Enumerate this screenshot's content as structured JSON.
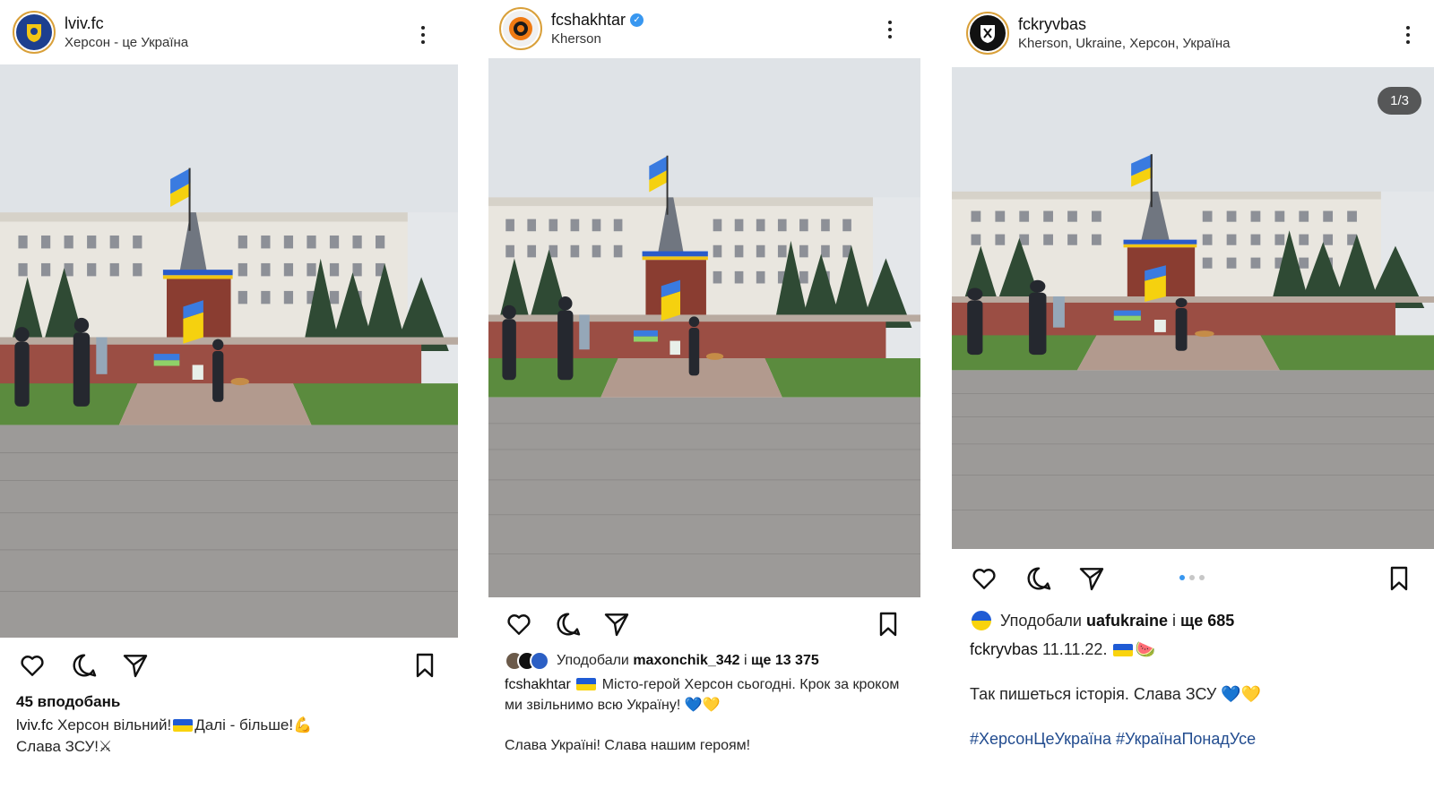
{
  "posts": [
    {
      "username": "lviv.fc",
      "location": "Херсон - це Україна",
      "verified": false,
      "likes_text": "45 вподобань",
      "caption_user": "lviv.fc",
      "caption_line1": "Херсон вільний!",
      "caption_after_flag": "Далі - більше!",
      "flex_emoji": "💪",
      "caption_line2": "Слава ЗСУ!",
      "swords_emoji": "⚔"
    },
    {
      "username": "fcshakhtar",
      "location": "Kherson",
      "verified": true,
      "liked_by_prefix": "Уподобали",
      "liked_by_user": "maxonchik_342",
      "liked_by_mid": "і",
      "liked_by_count": "ще 13 375",
      "caption_user": "fcshakhtar",
      "caption_text": "Місто-герой Херсон сьогодні. Крок за кроком ми звільнимо всю Україну!",
      "hearts": "💙💛",
      "caption_line2": "Слава Україні! Слава нашим героям!"
    },
    {
      "username": "fckryvbas",
      "location": "Kherson, Ukraine, Херсон, Україна",
      "verified": false,
      "photo_counter": "1/3",
      "liked_by_prefix": "Уподобали",
      "liked_by_user": "uafukraine",
      "liked_by_mid": "і",
      "liked_by_count": "ще 685",
      "caption_user": "fckryvbas",
      "caption_date": "11.11.22.",
      "watermelon": "🍉",
      "caption_line2": "Так пишеться історія. Слава ЗСУ",
      "hearts": "💙💛",
      "hashtags": "#ХерсонЦеУкраїна #УкраїнаПонадУсе",
      "carousel_dots": 3,
      "active_dot": 1
    }
  ],
  "icons": [
    "heart-icon",
    "comment-icon",
    "share-icon",
    "bookmark-icon",
    "more-options-icon"
  ],
  "colors": {
    "link_blue": "#224c8f",
    "verified_blue": "#3897f0",
    "flag_blue": "#1f5bd4",
    "flag_yellow": "#f9d30e"
  }
}
